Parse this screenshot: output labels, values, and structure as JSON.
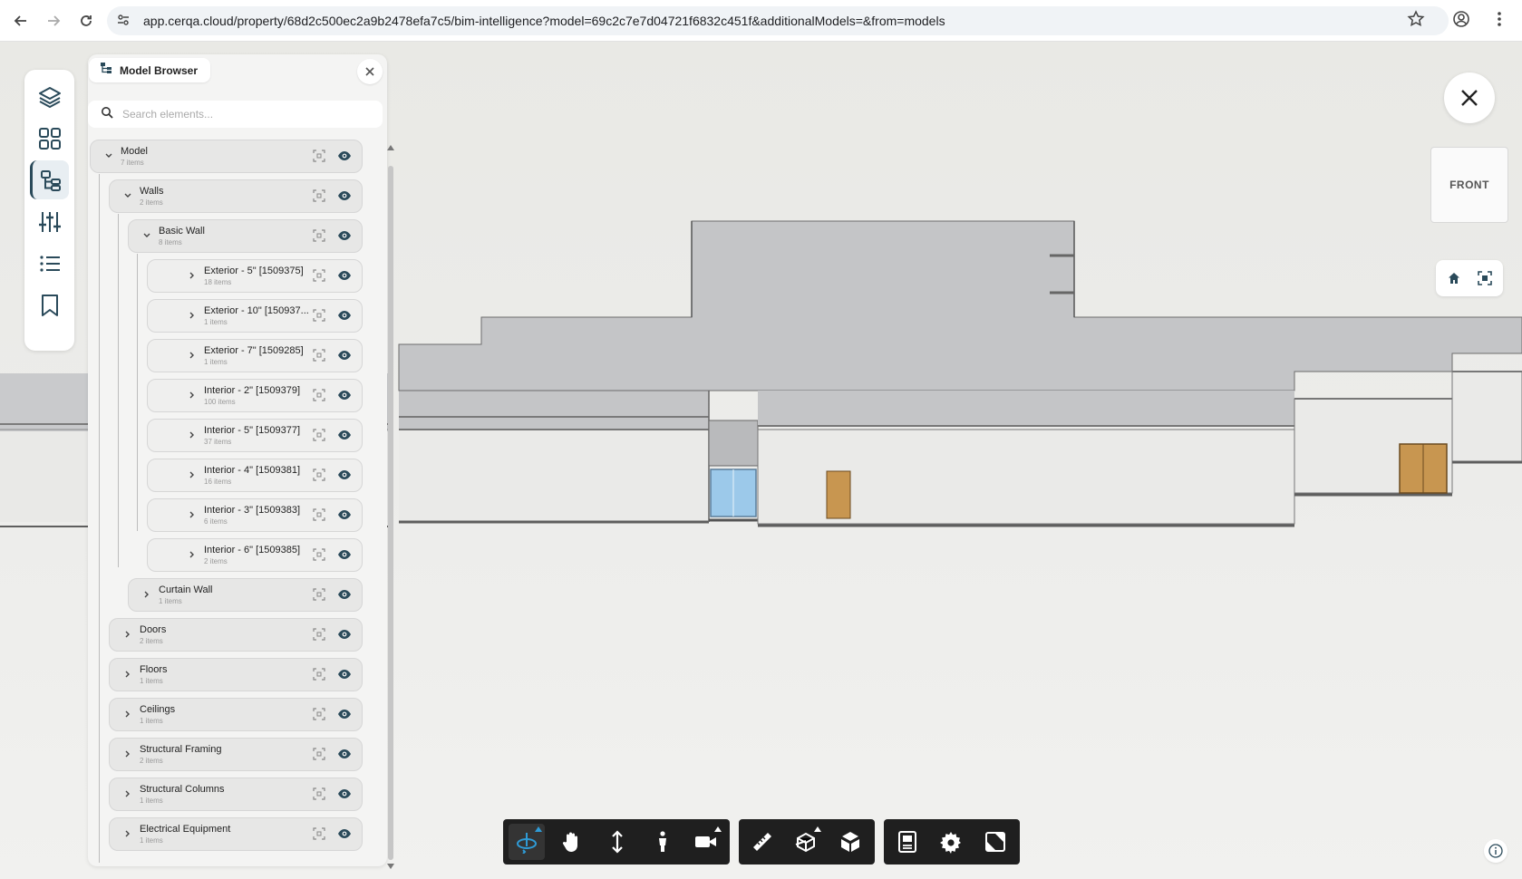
{
  "browser": {
    "url": "app.cerqa.cloud/property/68d2c500ec2a9b2478efa7c5/bim-intelligence?model=69c2c7e7d04721f6832c451f&additionalModels=&from=models"
  },
  "panel": {
    "title": "Model Browser",
    "search_placeholder": "Search elements...",
    "tree": [
      {
        "name": "Model",
        "count": "7 items",
        "level": 0,
        "expanded": true
      },
      {
        "name": "Walls",
        "count": "2 items",
        "level": 1,
        "expanded": true
      },
      {
        "name": "Basic Wall",
        "count": "8 items",
        "level": 2,
        "expanded": true
      },
      {
        "name": "Exterior - 5\" [1509375]",
        "count": "18 items",
        "level": 3,
        "expanded": false
      },
      {
        "name": "Exterior - 10\" [150937...",
        "count": "1 items",
        "level": 3,
        "expanded": false
      },
      {
        "name": "Exterior - 7\" [1509285]",
        "count": "1 items",
        "level": 3,
        "expanded": false
      },
      {
        "name": "Interior - 2\" [1509379]",
        "count": "100 items",
        "level": 3,
        "expanded": false
      },
      {
        "name": "Interior - 5\" [1509377]",
        "count": "37 items",
        "level": 3,
        "expanded": false
      },
      {
        "name": "Interior - 4\" [1509381]",
        "count": "16 items",
        "level": 3,
        "expanded": false
      },
      {
        "name": "Interior - 3\" [1509383]",
        "count": "6 items",
        "level": 3,
        "expanded": false
      },
      {
        "name": "Interior - 6\" [1509385]",
        "count": "2 items",
        "level": 3,
        "expanded": false
      },
      {
        "name": "Curtain Wall",
        "count": "1 items",
        "level": 2,
        "expanded": false
      },
      {
        "name": "Doors",
        "count": "2 items",
        "level": 1,
        "expanded": false
      },
      {
        "name": "Floors",
        "count": "1 items",
        "level": 1,
        "expanded": false
      },
      {
        "name": "Ceilings",
        "count": "1 items",
        "level": 1,
        "expanded": false
      },
      {
        "name": "Structural Framing",
        "count": "2 items",
        "level": 1,
        "expanded": false
      },
      {
        "name": "Structural Columns",
        "count": "1 items",
        "level": 1,
        "expanded": false
      },
      {
        "name": "Electrical Equipment",
        "count": "1 items",
        "level": 1,
        "expanded": false
      }
    ]
  },
  "viewcube": {
    "face": "FRONT"
  },
  "rail": {
    "icons": [
      "layers-icon",
      "grid-icon",
      "model-tree-icon",
      "sliders-icon",
      "list-icon",
      "bookmark-icon"
    ],
    "active": "model-tree-icon"
  },
  "toolbar": {
    "groups": [
      [
        "orbit-icon",
        "pan-icon",
        "dolly-icon",
        "walk-icon",
        "camera-icon"
      ],
      [
        "measure-icon",
        "section-icon",
        "explode-icon"
      ],
      [
        "properties-icon",
        "settings-icon",
        "fullscreen-icon"
      ]
    ],
    "active": "orbit-icon"
  },
  "colors": {
    "accent": "#2f9bd6",
    "toolbar_bg": "#1f1f1f",
    "wall_gray": "#c5c6c8",
    "door_wood": "#c89650",
    "glass_blue": "#9cc9ea"
  }
}
